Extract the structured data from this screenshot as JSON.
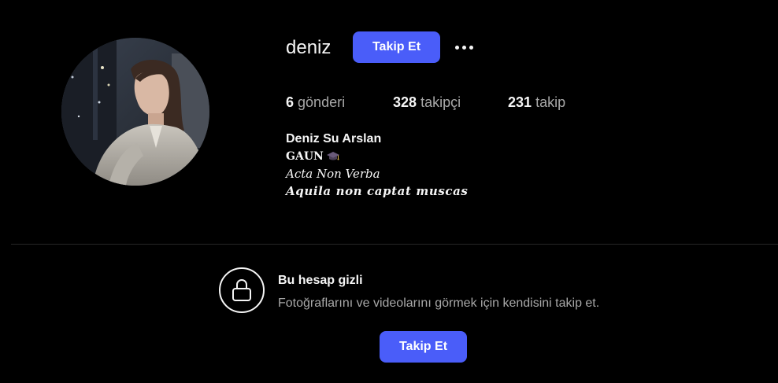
{
  "profile": {
    "username": "deniz",
    "follow_label": "Takip Et",
    "more_icon": "more-horizontal-icon",
    "avatar_alt": "profile-photo"
  },
  "stats": {
    "posts": {
      "count": "6",
      "label": "gönderi"
    },
    "followers": {
      "count": "328",
      "label": "takipçi"
    },
    "following": {
      "count": "231",
      "label": "takip"
    }
  },
  "bio": {
    "full_name": "Deniz Su Arslan",
    "line1": "GAUN",
    "line1_icon": "graduation-cap-icon",
    "line2": "Acta Non Verba",
    "line3": "Aquila non captat muscas"
  },
  "private_account": {
    "icon": "lock-icon",
    "title": "Bu hesap gizli",
    "description": "Fotoğraflarını ve videolarını görmek için kendisini takip et.",
    "follow_label": "Takip Et"
  },
  "colors": {
    "background": "#000000",
    "primary_button": "#4a5df9",
    "text_primary": "#f5f5f5",
    "text_secondary": "#a8a8a8",
    "divider": "#262626"
  }
}
